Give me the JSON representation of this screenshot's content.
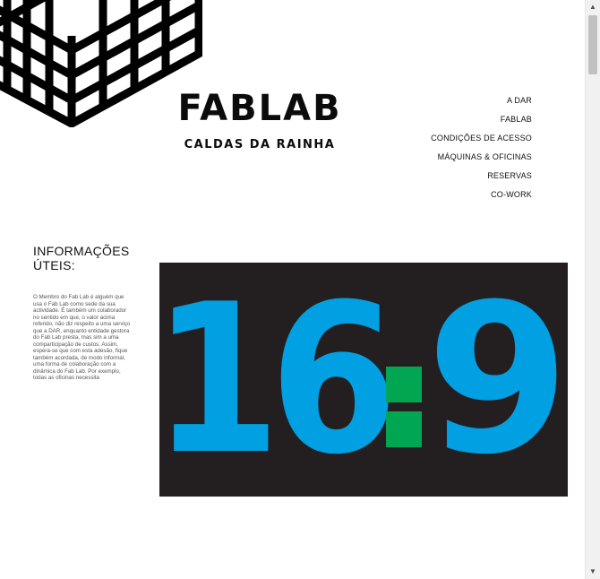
{
  "brand": {
    "title": "FABLAB",
    "subtitle": "CALDAS DA RAINHA"
  },
  "nav": {
    "items": [
      {
        "label": "A DAR"
      },
      {
        "label": "FABLAB"
      },
      {
        "label": "CONDIÇÕES DE ACESSO"
      },
      {
        "label": "MÁQUINAS & OFICINAS"
      },
      {
        "label": "RESERVAS"
      },
      {
        "label": "CO-WORK"
      }
    ]
  },
  "info": {
    "title": "INFORMAÇÕES ÚTEIS:",
    "text": "O Membro do Fab Lab é alguém que usa o Fab Lab como sede da sua actividade. É também um colaborador no sentido em que, o valor acima referido, não diz respeito a uma serviço que a DAR, enquanto entidade gestora do Fab Lab presta, mas sim a uma comparticipação de custos. Assim, espera-se que com esta adesão, fique também acordada, de modo informal, uma forma de colaboração com a dinâmica do Fab Lab. Por exemplo, todas as oficinas necessita"
  },
  "hero": {
    "text_left": "16",
    "text_right": "9",
    "colors": {
      "background": "#231f20",
      "digits": "#00a0e3",
      "colon": "#00a651"
    }
  },
  "icons": {
    "scroll_up": "triangle-up",
    "scroll_down": "triangle-down"
  }
}
